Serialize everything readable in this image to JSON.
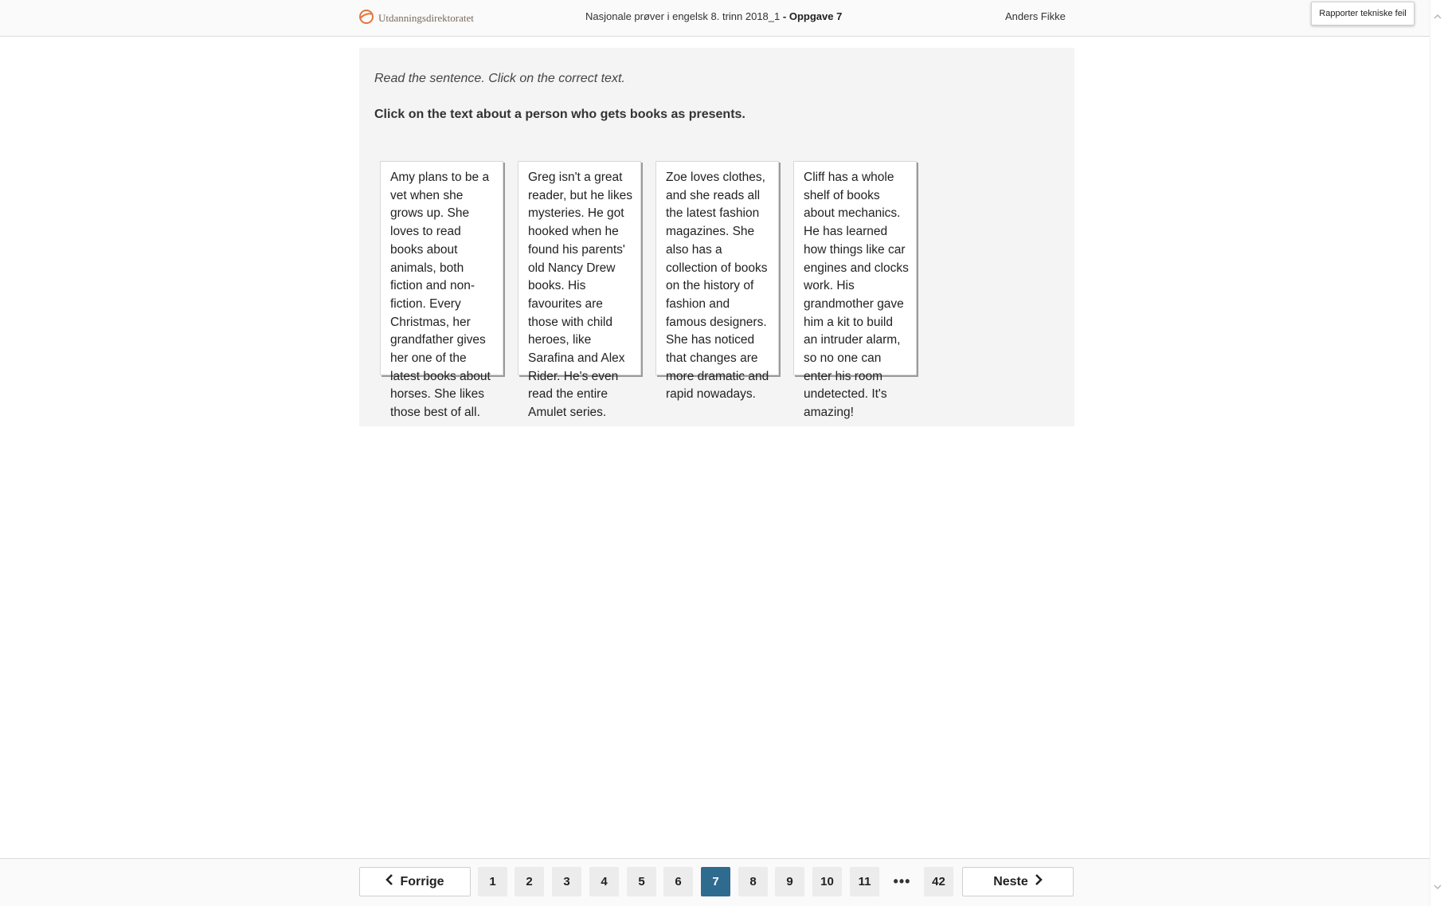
{
  "header": {
    "logo_text": "Utdanningsdirektoratet",
    "exam_title": "Nasjonale prøver i engelsk 8. trinn 2018_1",
    "task_label": "- Oppgave 7",
    "user_name": "Anders Fikke",
    "report_button": "Rapporter tekniske feil"
  },
  "task": {
    "instruction": "Read the sentence. Click on the correct text.",
    "question": "Click on the text about a person who gets books as presents.",
    "cards": [
      {
        "text": "Amy plans to be a vet when she grows up. She loves to read books about animals, both fiction and non-fiction. Every Christmas, her grandfather gives her one of the latest books about horses. She likes those best of all."
      },
      {
        "text": "Greg isn't a great reader, but he likes mysteries. He got hooked when he found his parents' old Nancy Drew books. His favourites are those with child heroes, like Sarafina and Alex Rider. He's even read the entire Amulet series."
      },
      {
        "text": "Zoe loves clothes, and she reads all the latest fashion magazines. She also has a collection of books on the history of fashion and famous designers. She has noticed that changes are more dramatic and rapid nowadays."
      },
      {
        "text": "Cliff has a whole shelf of books about mechanics. He has learned how things like car engines and clocks work. His grandmother gave him a kit to build an intruder alarm, so no one can enter his room undetected. It's amazing!"
      }
    ]
  },
  "footer": {
    "prev_label": "Forrige",
    "next_label": "Neste",
    "pages": [
      "1",
      "2",
      "3",
      "4",
      "5",
      "6",
      "7",
      "8",
      "9",
      "10",
      "11"
    ],
    "current_page": "7",
    "ellipsis": "•••",
    "last_page": "42"
  },
  "colors": {
    "accent_current_page": "#2f6b8e",
    "logo_orange": "#e8763a"
  },
  "icons": {
    "logo": "udir-logo-icon",
    "prev": "chevron-left-icon",
    "next": "chevron-right-icon",
    "scroll_up": "scroll-up-arrow-icon",
    "scroll_down": "scroll-down-arrow-icon"
  }
}
